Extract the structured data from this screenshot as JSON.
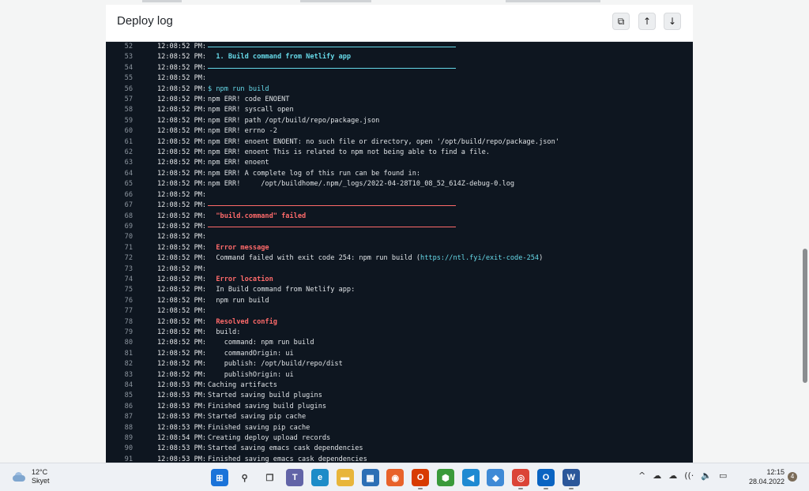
{
  "card": {
    "title": "Deploy log",
    "buttons": {
      "copy_icon": "⧉",
      "up_icon": "↑",
      "down_icon": "↓"
    }
  },
  "log": {
    "lines": [
      {
        "n": "52",
        "ts": "12:08:52 PM:",
        "style": "rule-cyan",
        "text": ""
      },
      {
        "n": "53",
        "ts": "12:08:52 PM:",
        "style": "cyan bold",
        "text": "  1. Build command from Netlify app"
      },
      {
        "n": "54",
        "ts": "12:08:52 PM:",
        "style": "rule-cyan",
        "text": ""
      },
      {
        "n": "55",
        "ts": "12:08:52 PM:",
        "style": "",
        "text": ""
      },
      {
        "n": "56",
        "ts": "12:08:52 PM:",
        "style": "cyan",
        "text": "$ npm run build"
      },
      {
        "n": "57",
        "ts": "12:08:52 PM:",
        "style": "",
        "text": "npm ERR! code ENOENT"
      },
      {
        "n": "58",
        "ts": "12:08:52 PM:",
        "style": "",
        "text": "npm ERR! syscall open"
      },
      {
        "n": "59",
        "ts": "12:08:52 PM:",
        "style": "",
        "text": "npm ERR! path /opt/build/repo/package.json"
      },
      {
        "n": "60",
        "ts": "12:08:52 PM:",
        "style": "",
        "text": "npm ERR! errno -2"
      },
      {
        "n": "61",
        "ts": "12:08:52 PM:",
        "style": "",
        "text": "npm ERR! enoent ENOENT: no such file or directory, open '/opt/build/repo/package.json'"
      },
      {
        "n": "62",
        "ts": "12:08:52 PM:",
        "style": "",
        "text": "npm ERR! enoent This is related to npm not being able to find a file."
      },
      {
        "n": "63",
        "ts": "12:08:52 PM:",
        "style": "",
        "text": "npm ERR! enoent"
      },
      {
        "n": "64",
        "ts": "12:08:52 PM:",
        "style": "",
        "text": "npm ERR! A complete log of this run can be found in:"
      },
      {
        "n": "65",
        "ts": "12:08:52 PM:",
        "style": "",
        "text": "npm ERR!     /opt/buildhome/.npm/_logs/2022-04-28T10_08_52_614Z-debug-0.log"
      },
      {
        "n": "66",
        "ts": "12:08:52 PM:",
        "style": "",
        "text": ""
      },
      {
        "n": "67",
        "ts": "12:08:52 PM:",
        "style": "rule-red",
        "text": ""
      },
      {
        "n": "68",
        "ts": "12:08:52 PM:",
        "style": "err bold",
        "text": "  \"build.command\" failed"
      },
      {
        "n": "69",
        "ts": "12:08:52 PM:",
        "style": "rule-red",
        "text": ""
      },
      {
        "n": "70",
        "ts": "12:08:52 PM:",
        "style": "",
        "text": ""
      },
      {
        "n": "71",
        "ts": "12:08:52 PM:",
        "style": "err bold",
        "text": "  Error message"
      },
      {
        "n": "72",
        "ts": "12:08:52 PM:",
        "style": "",
        "text": "  Command failed with exit code 254: npm run build (",
        "link": "https://ntl.fyi/exit-code-254",
        "after": ")"
      },
      {
        "n": "73",
        "ts": "12:08:52 PM:",
        "style": "",
        "text": ""
      },
      {
        "n": "74",
        "ts": "12:08:52 PM:",
        "style": "err bold",
        "text": "  Error location"
      },
      {
        "n": "75",
        "ts": "12:08:52 PM:",
        "style": "",
        "text": "  In Build command from Netlify app:"
      },
      {
        "n": "76",
        "ts": "12:08:52 PM:",
        "style": "",
        "text": "  npm run build"
      },
      {
        "n": "77",
        "ts": "12:08:52 PM:",
        "style": "",
        "text": ""
      },
      {
        "n": "78",
        "ts": "12:08:52 PM:",
        "style": "err bold",
        "text": "  Resolved config"
      },
      {
        "n": "79",
        "ts": "12:08:52 PM:",
        "style": "",
        "text": "  build:"
      },
      {
        "n": "80",
        "ts": "12:08:52 PM:",
        "style": "",
        "text": "    command: npm run build"
      },
      {
        "n": "81",
        "ts": "12:08:52 PM:",
        "style": "",
        "text": "    commandOrigin: ui"
      },
      {
        "n": "82",
        "ts": "12:08:52 PM:",
        "style": "",
        "text": "    publish: /opt/build/repo/dist"
      },
      {
        "n": "83",
        "ts": "12:08:52 PM:",
        "style": "",
        "text": "    publishOrigin: ui"
      },
      {
        "n": "84",
        "ts": "12:08:53 PM:",
        "style": "",
        "text": "Caching artifacts"
      },
      {
        "n": "85",
        "ts": "12:08:53 PM:",
        "style": "",
        "text": "Started saving build plugins"
      },
      {
        "n": "86",
        "ts": "12:08:53 PM:",
        "style": "",
        "text": "Finished saving build plugins"
      },
      {
        "n": "87",
        "ts": "12:08:53 PM:",
        "style": "",
        "text": "Started saving pip cache"
      },
      {
        "n": "88",
        "ts": "12:08:53 PM:",
        "style": "",
        "text": "Finished saving pip cache"
      },
      {
        "n": "89",
        "ts": "12:08:54 PM:",
        "style": "",
        "text": "Creating deploy upload records"
      },
      {
        "n": "90",
        "ts": "12:08:53 PM:",
        "style": "",
        "text": "Started saving emacs cask dependencies"
      },
      {
        "n": "91",
        "ts": "12:08:53 PM:",
        "style": "",
        "text": "Finished saving emacs cask dependencies"
      }
    ]
  },
  "taskbar": {
    "weather": {
      "temp": "12°C",
      "condition": "Skyet"
    },
    "apps": [
      {
        "name": "windows-start",
        "glyph": "⊞",
        "color": "#1a73d9",
        "state": ""
      },
      {
        "name": "search",
        "glyph": "⚲",
        "color": "#3a3a3a",
        "state": ""
      },
      {
        "name": "task-view",
        "glyph": "❐",
        "color": "#3a3a3a",
        "state": ""
      },
      {
        "name": "teams",
        "glyph": "T",
        "color": "#6264a7",
        "state": ""
      },
      {
        "name": "edge",
        "glyph": "e",
        "color": "#1d8cc8",
        "state": ""
      },
      {
        "name": "file-explorer",
        "glyph": "▬",
        "color": "#e8b53a",
        "state": ""
      },
      {
        "name": "store",
        "glyph": "▦",
        "color": "#2c6fb5",
        "state": ""
      },
      {
        "name": "firefox",
        "glyph": "◉",
        "color": "#e8622a",
        "state": "active"
      },
      {
        "name": "office",
        "glyph": "O",
        "color": "#d83b01",
        "state": "running"
      },
      {
        "name": "app-green",
        "glyph": "⬢",
        "color": "#3a9a3a",
        "state": ""
      },
      {
        "name": "vscode",
        "glyph": "◀",
        "color": "#1f8ad2",
        "state": ""
      },
      {
        "name": "app-shape",
        "glyph": "◆",
        "color": "#3f8ad6",
        "state": ""
      },
      {
        "name": "chrome",
        "glyph": "◎",
        "color": "#db4437",
        "state": "running"
      },
      {
        "name": "outlook",
        "glyph": "O",
        "color": "#0a64c2",
        "state": "running"
      },
      {
        "name": "word",
        "glyph": "W",
        "color": "#2b579a",
        "state": "running"
      }
    ],
    "tray_icons": [
      "^",
      "☁",
      "☁",
      "((·",
      "🔈",
      "▭"
    ],
    "time": "12:15",
    "date": "28.04.2022",
    "notification_count": "4"
  }
}
